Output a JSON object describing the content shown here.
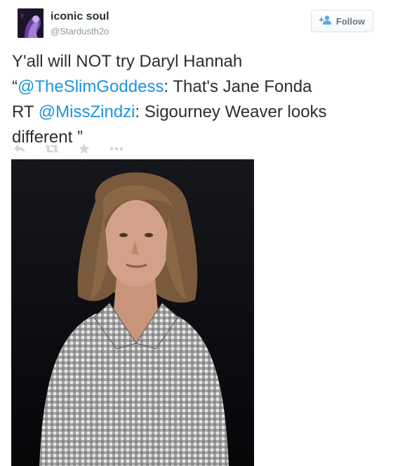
{
  "user": {
    "display_name": "iconic soul",
    "handle": "@Stardusth2o"
  },
  "follow_button": {
    "label": "Follow",
    "icon": "add-user-icon"
  },
  "tweet": {
    "line1": "Y'all will NOT try Daryl Hannah",
    "open_quote": "“",
    "mention1": "@TheSlimGoddess",
    "text2": ": That's Jane Fonda",
    "rt_prefix": "RT ",
    "mention2": "@MissZindzi",
    "text3": ": Sigourney Weaver looks",
    "text4": "different ”"
  },
  "actions": [
    "reply-icon",
    "retweet-icon",
    "favorite-star-icon",
    "more-dots-icon"
  ],
  "colors": {
    "text": "#292f33",
    "muted": "#8899a6",
    "link": "#1b95e0",
    "action_icons": "#ccd6dd",
    "follow_icon": "#55acee"
  }
}
